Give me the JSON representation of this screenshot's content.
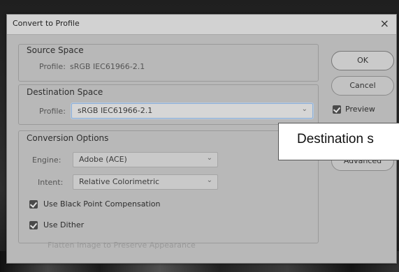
{
  "dialog": {
    "title": "Convert to Profile",
    "close_glyph": "×"
  },
  "source_space": {
    "heading": "Source Space",
    "profile_label": "Profile:",
    "profile_value": "sRGB IEC61966-2.1"
  },
  "destination_space": {
    "heading": "Destination Space",
    "profile_label": "Profile:",
    "profile_value": "sRGB IEC61966-2.1",
    "chevron": "⌄"
  },
  "conversion_options": {
    "heading": "Conversion Options",
    "engine_label": "Engine:",
    "engine_value": "Adobe (ACE)",
    "intent_label": "Intent:",
    "intent_value": "Relative Colorimetric",
    "chevron": "⌄"
  },
  "checkboxes": {
    "black_point": "Use Black Point Compensation",
    "dither": "Use Dither",
    "flatten": "Flatten Image to Preserve Appearance",
    "preview": "Preview"
  },
  "buttons": {
    "ok": "OK",
    "cancel": "Cancel",
    "advanced": "Advanced"
  },
  "callout": {
    "text": "Destination s"
  }
}
